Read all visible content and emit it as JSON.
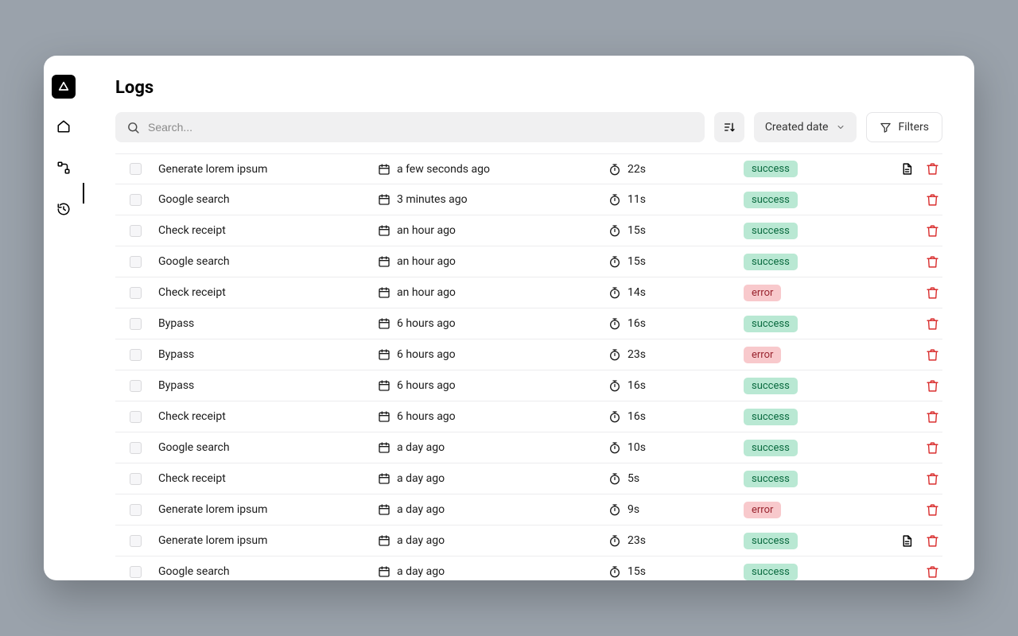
{
  "page": {
    "title": "Logs"
  },
  "sidebar": {
    "icons": [
      "logo",
      "home",
      "flow",
      "history"
    ],
    "active": "history"
  },
  "toolbar": {
    "search_placeholder": "Search...",
    "sort_label": "Created date",
    "filters_label": "Filters"
  },
  "status_colors": {
    "success": "#b9e8d3",
    "error": "#f8c9cc"
  },
  "logs": [
    {
      "name": "Generate lorem ipsum",
      "date": "a few seconds ago",
      "duration": "22s",
      "status": "success",
      "has_doc": true
    },
    {
      "name": "Google search",
      "date": "3 minutes ago",
      "duration": "11s",
      "status": "success",
      "has_doc": false
    },
    {
      "name": "Check receipt",
      "date": "an hour ago",
      "duration": "15s",
      "status": "success",
      "has_doc": false
    },
    {
      "name": "Google search",
      "date": "an hour ago",
      "duration": "15s",
      "status": "success",
      "has_doc": false
    },
    {
      "name": "Check receipt",
      "date": "an hour ago",
      "duration": "14s",
      "status": "error",
      "has_doc": false
    },
    {
      "name": "Bypass",
      "date": "6 hours ago",
      "duration": "16s",
      "status": "success",
      "has_doc": false
    },
    {
      "name": "Bypass",
      "date": "6 hours ago",
      "duration": "23s",
      "status": "error",
      "has_doc": false
    },
    {
      "name": "Bypass",
      "date": "6 hours ago",
      "duration": "16s",
      "status": "success",
      "has_doc": false
    },
    {
      "name": "Check receipt",
      "date": "6 hours ago",
      "duration": "16s",
      "status": "success",
      "has_doc": false
    },
    {
      "name": "Google search",
      "date": "a day ago",
      "duration": "10s",
      "status": "success",
      "has_doc": false
    },
    {
      "name": "Check receipt",
      "date": "a day ago",
      "duration": "5s",
      "status": "success",
      "has_doc": false
    },
    {
      "name": "Generate lorem ipsum",
      "date": "a day ago",
      "duration": "9s",
      "status": "error",
      "has_doc": false
    },
    {
      "name": "Generate lorem ipsum",
      "date": "a day ago",
      "duration": "23s",
      "status": "success",
      "has_doc": true
    },
    {
      "name": "Google search",
      "date": "a day ago",
      "duration": "15s",
      "status": "success",
      "has_doc": false
    }
  ]
}
